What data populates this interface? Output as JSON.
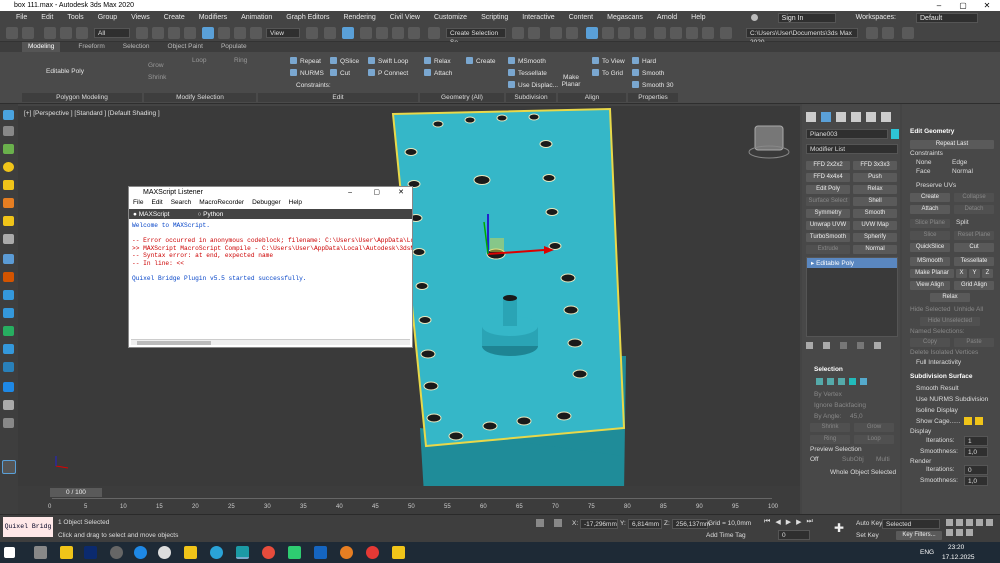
{
  "window": {
    "title": "box 111.max - Autodesk 3ds Max 2020"
  },
  "menu": {
    "items": [
      "File",
      "Edit",
      "Tools",
      "Group",
      "Views",
      "Create",
      "Modifiers",
      "Animation",
      "Graph Editors",
      "Rendering",
      "Civil View",
      "Customize",
      "Scripting",
      "Interactive",
      "Content",
      "Megascans",
      "Arnold",
      "Help"
    ],
    "signin": "Sign In",
    "workspaces_label": "Workspaces:",
    "workspaces_value": "Default"
  },
  "toolbar": {
    "filter": "All",
    "view": "View",
    "selection_set": "Create Selection Se",
    "path": "C:\\Users\\User\\Documents\\3ds Max 2020"
  },
  "ribbon_tabs": [
    "Modeling",
    "Freeform",
    "Selection",
    "Object Paint",
    "Populate"
  ],
  "ribbon": {
    "editable_poly": "Editable Poly",
    "grow": "Grow",
    "shrink": "Shrink",
    "loop": "Loop",
    "ring": "Ring",
    "repeat": "Repeat",
    "qslice": "QSlice",
    "swift_loop": "Swift Loop",
    "nurms": "NURMS",
    "cut": "Cut",
    "p_connect": "P Connect",
    "constraints": "Constraints:",
    "relax": "Relax",
    "create": "Create",
    "attach": "Attach",
    "msmooth": "MSmooth",
    "tessellate": "Tessellate",
    "use_displac": "Use Displac...",
    "make_planar": "Make Planar",
    "to_view": "To View",
    "to_grid": "To Grid",
    "hard": "Hard",
    "smooth": "Smooth",
    "smooth30": "Smooth 30",
    "groups": [
      "Polygon Modeling",
      "Modify Selection",
      "Edit",
      "Geometry (All)",
      "Subdivision",
      "Align",
      "Properties"
    ]
  },
  "viewport": {
    "label": "[+] [Perspective ] [Standard ] [Default Shading ]"
  },
  "listener": {
    "title": "MAXScript Listener",
    "menu": [
      "File",
      "Edit",
      "Search",
      "MacroRecorder",
      "Debugger",
      "Help"
    ],
    "tabs": [
      "MAXScript",
      "Python"
    ],
    "lines": [
      {
        "text": "Welcome to MAXScript.",
        "cls": "blue"
      },
      {
        "text": "",
        "cls": ""
      },
      {
        "text": "-- Error occurred in anonymous codeblock; filename: C:\\Users\\User\\AppData\\Loc",
        "cls": "red"
      },
      {
        "text": ">> MAXScript MacroScript Compile - C:\\Users\\User\\AppData\\Local\\Autodesk\\3dsMa",
        "cls": "red"
      },
      {
        "text": "-- Syntax error: at end, expected name",
        "cls": "red"
      },
      {
        "text": "--  In line: <<",
        "cls": "red"
      },
      {
        "text": "",
        "cls": ""
      },
      {
        "text": "Quixel Bridge Plugin v5.5 started successfully.",
        "cls": "blue"
      }
    ]
  },
  "cmd": {
    "object_name": "Plane003",
    "modifier_list": "Modifier List",
    "buttons": [
      [
        "FFD 2x2x2",
        "FFD 3x3x3"
      ],
      [
        "FFD 4x4x4",
        "Push"
      ],
      [
        "Edit Poly",
        "Relax"
      ],
      [
        "Surface Select",
        "Shell"
      ],
      [
        "Symmetry",
        "Smooth"
      ],
      [
        "Unwrap UVW",
        "UVW Map"
      ],
      [
        "TurboSmooth",
        "Spherify"
      ],
      [
        "Extrude",
        "Normal"
      ]
    ],
    "stack_item": "Editable Poly",
    "selection": {
      "header": "Selection",
      "by_vertex": "By Vertex",
      "ignore_backfacing": "Ignore Backfacing",
      "by_angle": "By Angle:",
      "angle": "45,0",
      "shrink": "Shrink",
      "grow": "Grow",
      "ring": "Ring",
      "loop": "Loop",
      "preview": "Preview Selection",
      "off": "Off",
      "subobj": "SubObj",
      "multi": "Multi",
      "whole": "Whole Object Selected"
    }
  },
  "edit_geom": {
    "header": "Edit Geometry",
    "repeat_last": "Repeat Last",
    "constraints": "Constraints",
    "none": "None",
    "edge": "Edge",
    "face": "Face",
    "normal": "Normal",
    "preserve_uvs": "Preserve UVs",
    "create": "Create",
    "collapse": "Collapse",
    "attach": "Attach",
    "detach": "Detach",
    "slice_plane": "Slice Plane",
    "split": "Split",
    "slice": "Slice",
    "reset_plane": "Reset Plane",
    "quickslice": "QuickSlice",
    "cut": "Cut",
    "msmooth": "MSmooth",
    "tessellate": "Tessellate",
    "make_planar": "Make Planar",
    "x": "X",
    "y": "Y",
    "z": "Z",
    "view_align": "View Align",
    "grid_align": "Grid Align",
    "relax": "Relax",
    "hide_selected": "Hide Selected",
    "unhide_all": "Unhide All",
    "hide_unselected": "Hide Unselected",
    "named_selections": "Named Selections:",
    "copy": "Copy",
    "paste": "Paste",
    "delete_isolated": "Delete Isolated Vertices",
    "full_interactivity": "Full Interactivity"
  },
  "subdiv": {
    "header": "Subdivision Surface",
    "smooth_result": "Smooth Result",
    "use_nurms": "Use NURMS Subdivision",
    "isoline": "Isoline Display",
    "show_cage": "Show Cage......",
    "display": "Display",
    "iterations_label": "Iterations:",
    "iterations": "1",
    "smoothness_label": "Smoothness:",
    "smoothness": "1,0",
    "render": "Render",
    "r_iterations": "0",
    "r_smoothness": "1,0"
  },
  "timeline": {
    "frame": "0 / 100",
    "ticks": [
      "0",
      "5",
      "10",
      "15",
      "20",
      "25",
      "30",
      "35",
      "40",
      "45",
      "50",
      "55",
      "60",
      "65",
      "70",
      "75",
      "80",
      "85",
      "90",
      "95",
      "100"
    ]
  },
  "status": {
    "quixel": "Quixel Bridg",
    "selected": "1 Object Selected",
    "hint": "Click and drag to select and move objects",
    "x_label": "X:",
    "x": "-17,296mm",
    "y_label": "Y:",
    "y": "6,814mm",
    "z_label": "Z:",
    "z": "256,137mm",
    "grid": "Grid = 10,0mm",
    "add_time_tag": "Add Time Tag",
    "auto_key": "Auto Key",
    "set_key": "Set Key",
    "selected_mode": "Selected",
    "key_filters": "Key Filters...",
    "frame": "0"
  },
  "taskbar": {
    "time": "23:20",
    "date": "17.12.2025",
    "lang": "ENG"
  }
}
